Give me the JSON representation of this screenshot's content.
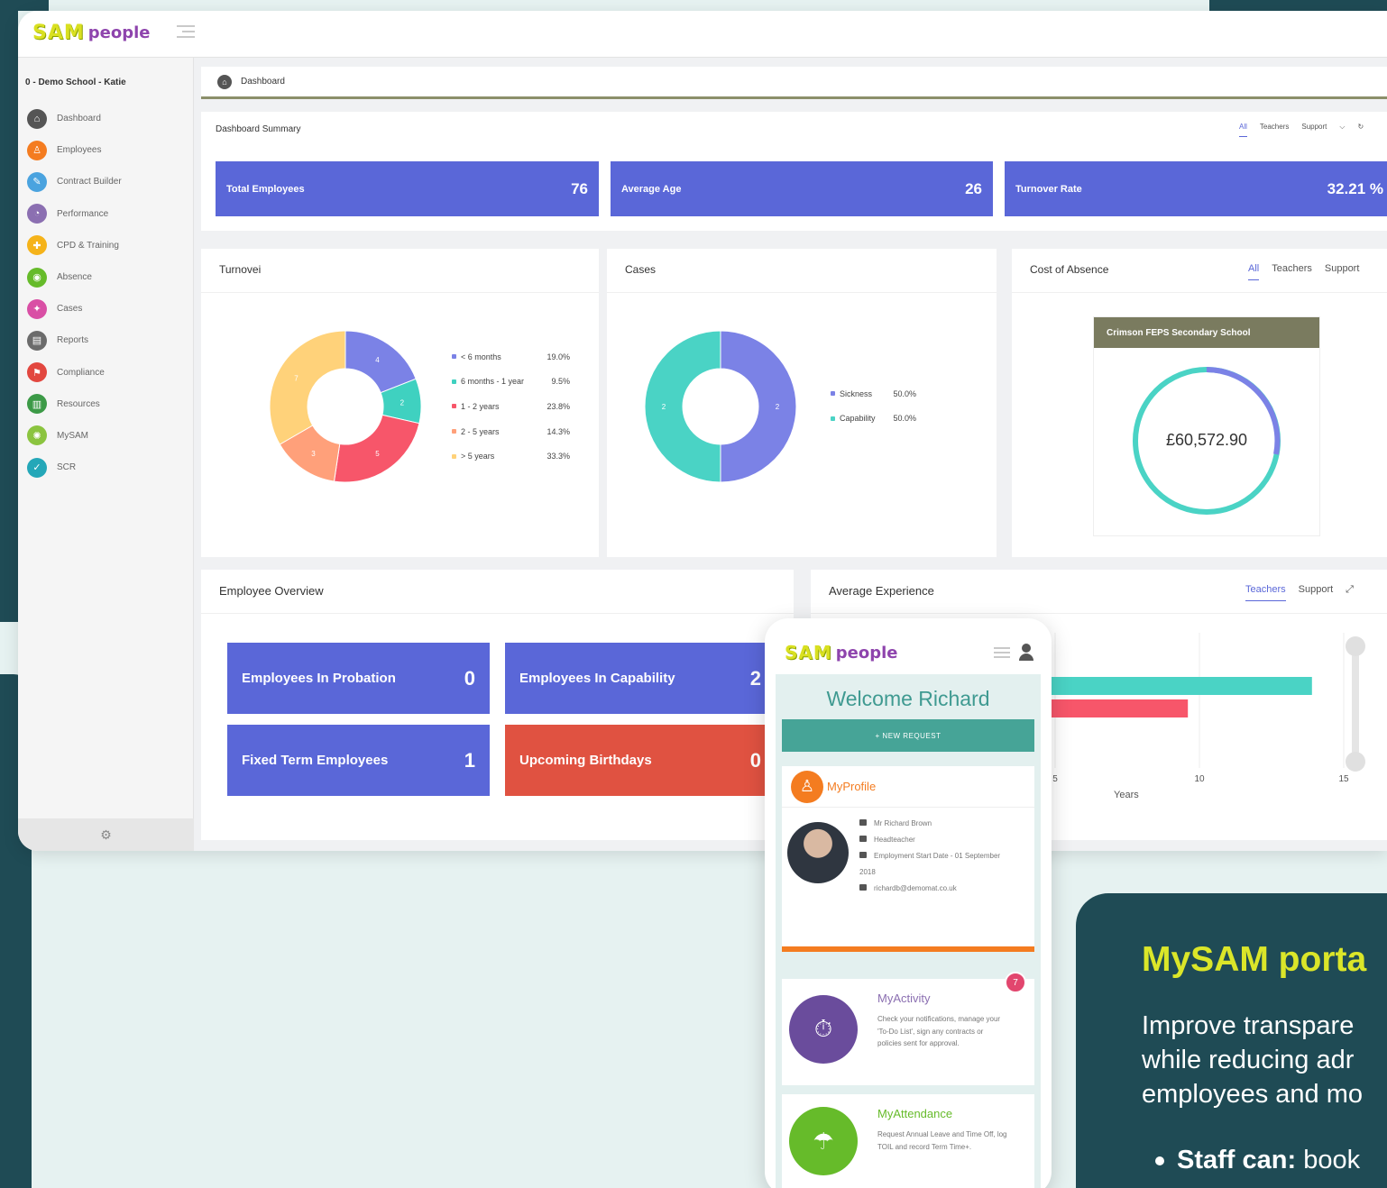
{
  "brand": {
    "sam": "SAM",
    "people": "people"
  },
  "school": "0 - Demo School - Katie",
  "sidebar": {
    "items": [
      {
        "label": "Dashboard",
        "icon": "home-icon",
        "color": "#555555"
      },
      {
        "label": "Employees",
        "icon": "person-icon",
        "color": "#f47c20"
      },
      {
        "label": "Contract Builder",
        "icon": "contract-icon",
        "color": "#4aa3df"
      },
      {
        "label": "Performance",
        "icon": "performance-icon",
        "color": "#8b6fb1"
      },
      {
        "label": "CPD & Training",
        "icon": "training-icon",
        "color": "#f5b31a"
      },
      {
        "label": "Absence",
        "icon": "absence-icon",
        "color": "#66bb2a"
      },
      {
        "label": "Cases",
        "icon": "cases-icon",
        "color": "#d94fa5"
      },
      {
        "label": "Reports",
        "icon": "reports-icon",
        "color": "#6b6b6b"
      },
      {
        "label": "Compliance",
        "icon": "compliance-icon",
        "color": "#e2473f"
      },
      {
        "label": "Resources",
        "icon": "resources-icon",
        "color": "#3c9a47"
      },
      {
        "label": "MySAM",
        "icon": "mysam-icon",
        "color": "#8bc43f"
      },
      {
        "label": "SCR",
        "icon": "shield-check-icon",
        "color": "#24a7b8"
      }
    ]
  },
  "breadcrumb": "Dashboard",
  "summary": {
    "title": "Dashboard Summary",
    "filters": [
      "All",
      "Teachers",
      "Support"
    ],
    "kpis": [
      {
        "label": "Total Employees",
        "value": "76"
      },
      {
        "label": "Average Age",
        "value": "26"
      },
      {
        "label": "Turnover Rate",
        "value": "32.21 %"
      }
    ]
  },
  "turnover": {
    "title": "Turnovei",
    "legend": [
      {
        "label": "< 6 months",
        "pct": "19.0%",
        "color": "#7b82e6"
      },
      {
        "label": "6 months - 1 year",
        "pct": "9.5%",
        "color": "#3fd1c0"
      },
      {
        "label": "1 - 2 years",
        "pct": "23.8%",
        "color": "#f7566a"
      },
      {
        "label": "2 - 5 years",
        "pct": "14.3%",
        "color": "#ffa07a"
      },
      {
        "label": "> 5 years",
        "pct": "33.3%",
        "color": "#ffd27a"
      }
    ]
  },
  "cases": {
    "title": "Cases",
    "legend": [
      {
        "label": "Sickness",
        "pct": "50.0%",
        "color": "#7b82e6"
      },
      {
        "label": "Capability",
        "pct": "50.0%",
        "color": "#4ad3c5"
      }
    ]
  },
  "absence": {
    "title": "Cost of Absence",
    "filters": [
      "All",
      "Teachers",
      "Support"
    ],
    "school_name": "Crimson FEPS Secondary School",
    "cost": "£60,572.90"
  },
  "overview": {
    "title": "Employee Overview",
    "tiles": [
      {
        "label": "Employees In Probation",
        "value": "0"
      },
      {
        "label": "Employees In Capability",
        "value": "2"
      },
      {
        "label": "Fixed Term Employees",
        "value": "1"
      },
      {
        "label": "Upcoming Birthdays",
        "value": "0"
      }
    ]
  },
  "experience": {
    "title": "Average Experience",
    "filters": [
      "Teachers",
      "Support"
    ],
    "xlabel": "Years"
  },
  "chart_data": [
    {
      "type": "pie",
      "title": "Turnovei",
      "categories": [
        "< 6 months",
        "6 months - 1 year",
        "1 - 2 years",
        "2 - 5 years",
        "> 5 years"
      ],
      "values": [
        4,
        2,
        5,
        3,
        7
      ],
      "percentages": [
        "19.0%",
        "9.5%",
        "23.8%",
        "14.3%",
        "33.3%"
      ]
    },
    {
      "type": "pie",
      "title": "Cases",
      "categories": [
        "Sickness",
        "Capability"
      ],
      "values": [
        2,
        2
      ],
      "percentages": [
        "50.0%",
        "50.0%"
      ]
    },
    {
      "type": "bar",
      "title": "Average Experience",
      "orientation": "horizontal",
      "xlabel": "Years",
      "xticks": [
        "5",
        "10",
        "15"
      ],
      "series": [
        {
          "values": [
            13.9
          ],
          "color": "#4ad3c5"
        },
        {
          "values": [
            9.6
          ],
          "color": "#f7566a"
        }
      ]
    }
  ],
  "phone": {
    "welcome": "Welcome Richard",
    "new_request": "+ NEW REQUEST",
    "profile": {
      "title": "MyProfile",
      "name": "Mr Richard Brown",
      "role": "Headteacher",
      "start": "Employment Start Date - 01 September 2018",
      "email": "richardb@demomat.co.uk"
    },
    "activity": {
      "title": "MyActivity",
      "badge": "7",
      "desc": "Check your notifications, manage your 'To-Do List', sign any contracts or policies sent for approval."
    },
    "attendance": {
      "title": "MyAttendance",
      "desc": "Request Annual Leave and Time Off, log TOIL and record Term Time+."
    }
  },
  "promo": {
    "title": "MySAM porta",
    "lines": [
      "Improve transpare",
      "while reducing adr",
      "employees and mo"
    ],
    "bullet_bold": "Staff can:",
    "bullet_text": " book"
  }
}
